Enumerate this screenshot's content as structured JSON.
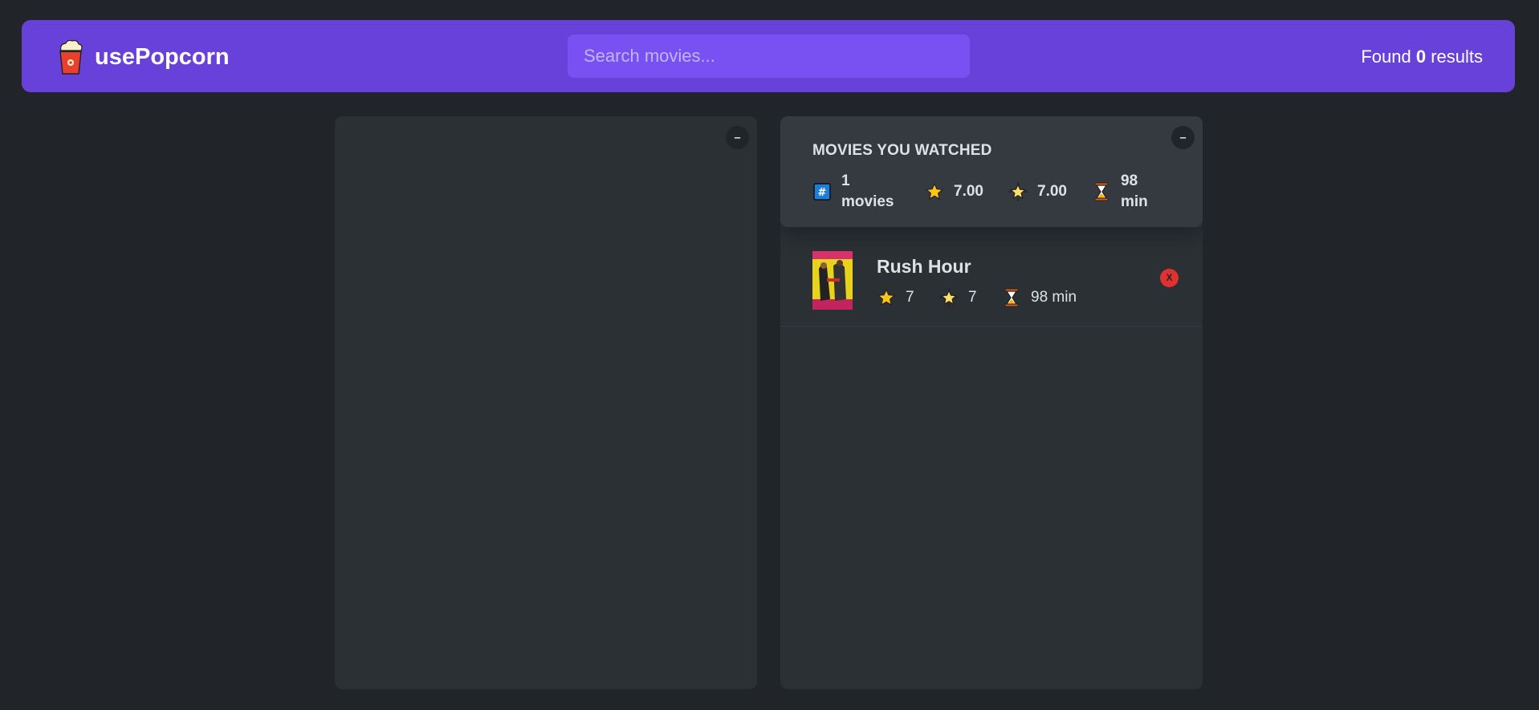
{
  "nav": {
    "app_name": "usePopcorn",
    "search": {
      "placeholder": "Search movies...",
      "value": ""
    },
    "results": {
      "prefix": "Found",
      "count": "0",
      "suffix": "results"
    }
  },
  "list_box": {
    "toggle_label": "–"
  },
  "watched_box": {
    "toggle_label": "–",
    "summary": {
      "heading": "MOVIES YOU WATCHED",
      "count_number": "1",
      "count_label": "movies",
      "avg_imdb_rating": "7.00",
      "avg_user_rating": "7.00",
      "avg_runtime_number": "98",
      "avg_runtime_unit": "min"
    },
    "movies": [
      {
        "title": "Rush Hour",
        "imdb_rating": "7",
        "user_rating": "7",
        "runtime": "98 min",
        "delete_label": "X"
      }
    ]
  },
  "icons": {
    "count": "hash-icon",
    "imdb": "star-icon",
    "user": "glowing-star-icon",
    "runtime": "hourglass-icon"
  },
  "colors": {
    "background": "#212529",
    "nav": "#6741d9",
    "search": "#7950f2",
    "box": "#2b3035",
    "summary": "#343a40",
    "delete": "#e03131"
  }
}
